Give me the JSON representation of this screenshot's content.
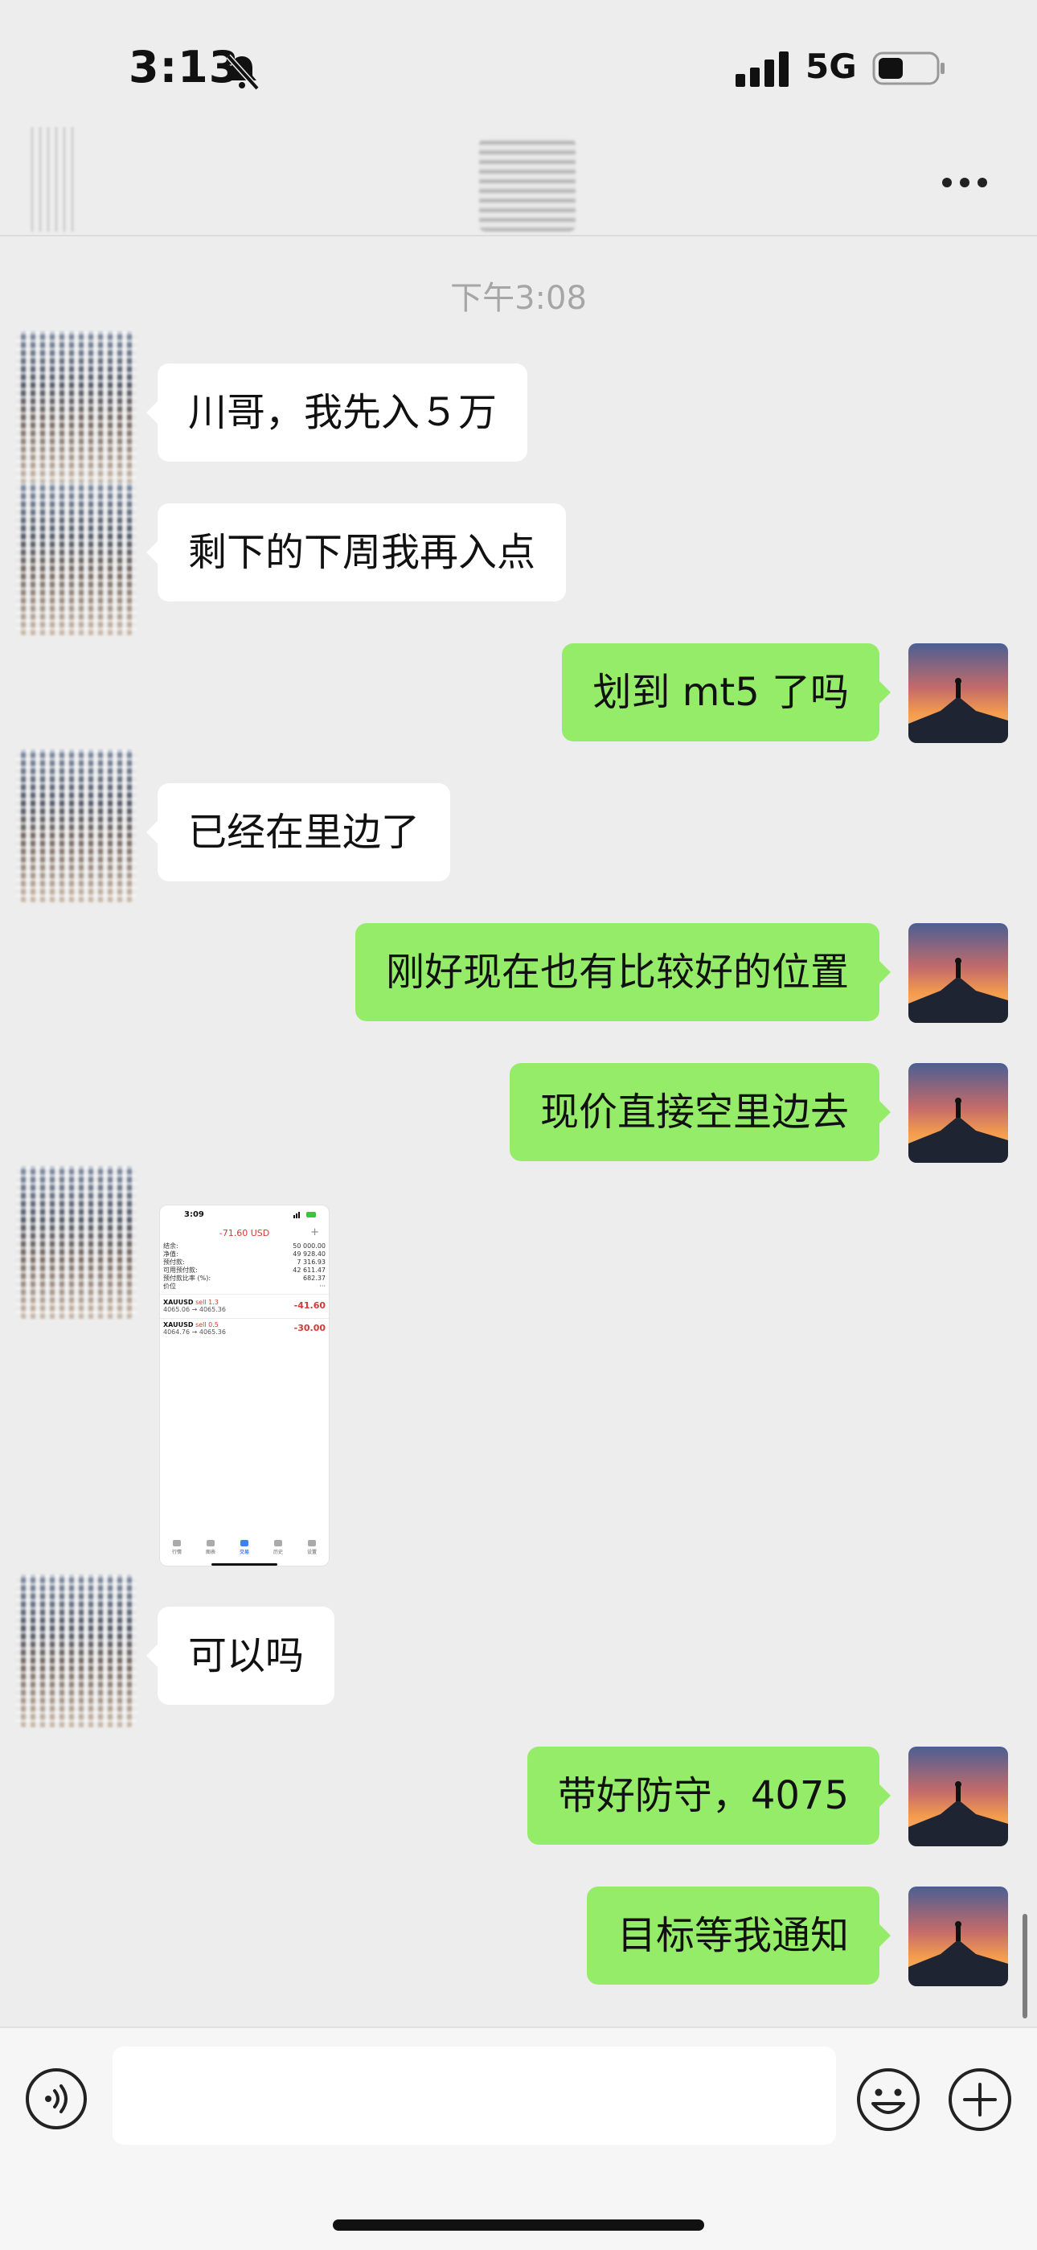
{
  "status_bar": {
    "time": "3:13",
    "network": "5G"
  },
  "chat": {
    "timestamp": "下午3:08",
    "messages": [
      {
        "side": "left",
        "text": "川哥，我先入５万"
      },
      {
        "side": "left",
        "text": "剩下的下周我再入点"
      },
      {
        "side": "right",
        "text": "划到 mt5 了吗"
      },
      {
        "side": "left",
        "text": "已经在里边了"
      },
      {
        "side": "right",
        "text": "刚好现在也有比较好的位置"
      },
      {
        "side": "right",
        "text": "现价直接空里边去"
      },
      {
        "side": "left",
        "text": "可以吗"
      },
      {
        "side": "right",
        "text": "带好防守，4075"
      },
      {
        "side": "right",
        "text": "目标等我通知"
      }
    ]
  },
  "image_message": {
    "time": "3:09",
    "pl": "-71.60 USD",
    "rows": [
      {
        "label": "结余:",
        "value": "50 000.00"
      },
      {
        "label": "净值:",
        "value": "49 928.40"
      },
      {
        "label": "预付款:",
        "value": "7 316.93"
      },
      {
        "label": "可用预付款:",
        "value": "42 611.47"
      },
      {
        "label": "预付款比率 (%):",
        "value": "682.37"
      },
      {
        "label": "价位",
        "value": "···"
      }
    ],
    "positions": [
      {
        "symbol": "XAUUSD",
        "side": "sell 1.3",
        "prices": "4065.06 → 4065.36",
        "value": "-41.60"
      },
      {
        "symbol": "XAUUSD",
        "side": "sell 0.5",
        "prices": "4064.76 → 4065.36",
        "value": "-30.00"
      }
    ],
    "tabs": [
      "行情",
      "图表",
      "交易",
      "历史",
      "设置"
    ]
  },
  "colors": {
    "self_bubble": "#95ec69",
    "other_bubble": "#ffffff",
    "background": "#ededed"
  }
}
